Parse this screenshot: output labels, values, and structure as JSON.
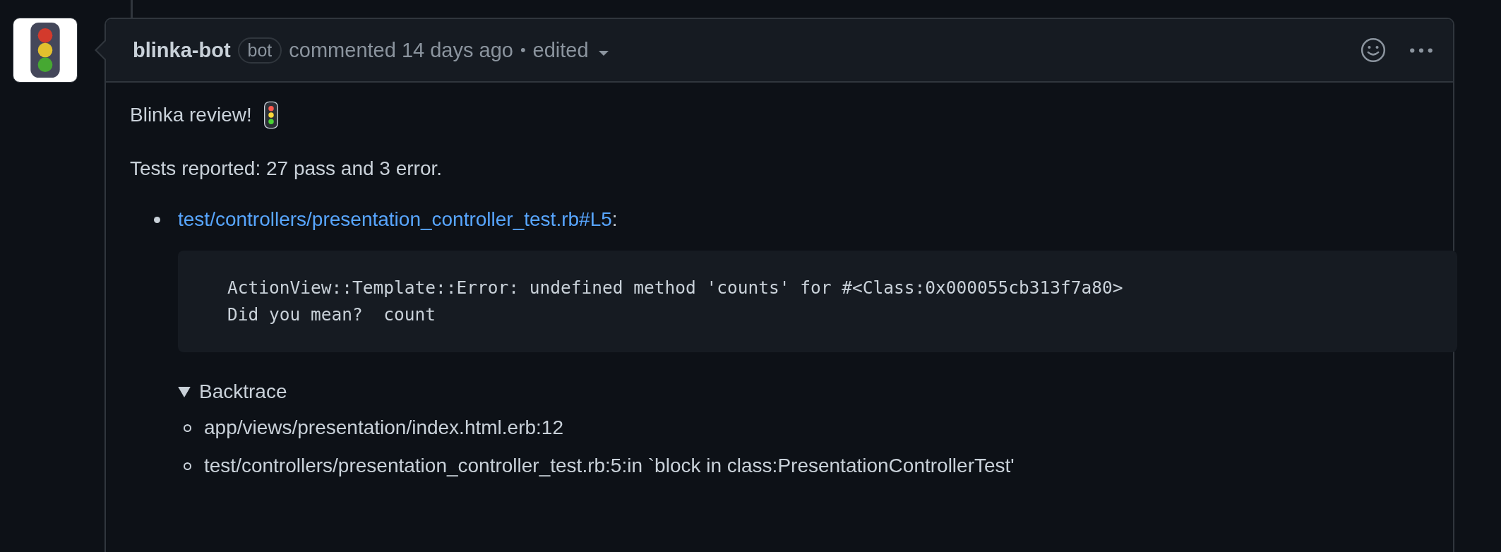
{
  "comment": {
    "author": "blinka-bot",
    "badge": "bot",
    "meta": "commented 14 days ago",
    "separator": "•",
    "edited": "edited",
    "body": {
      "title": "Blinka review!",
      "summary": "Tests reported: 27 pass and 3 error.",
      "failures": [
        {
          "link": "test/controllers/presentation_controller_test.rb#L5",
          "suffix": ":",
          "code": [
            "ActionView::Template::Error: undefined method 'counts' for #<Class:0x000055cb313f7a80>",
            "Did you mean?  count"
          ],
          "backtrace": {
            "label": "Backtrace",
            "expanded": true,
            "items": [
              "app/views/presentation/index.html.erb:12",
              "test/controllers/presentation_controller_test.rb:5:in `block in class:PresentationControllerTest'"
            ]
          }
        }
      ]
    }
  }
}
